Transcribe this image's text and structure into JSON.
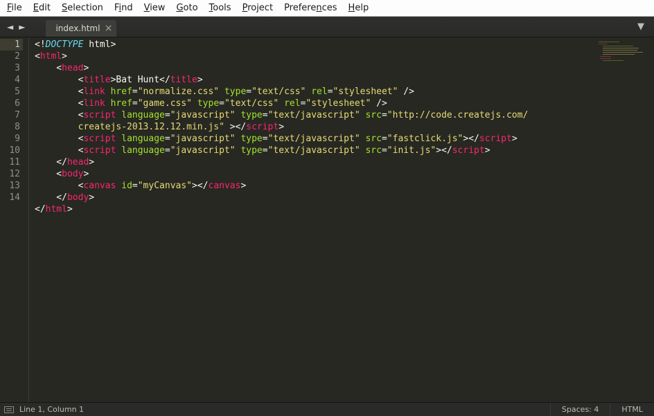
{
  "menubar": [
    {
      "label": "File",
      "ul": "F"
    },
    {
      "label": "Edit",
      "ul": "E"
    },
    {
      "label": "Selection",
      "ul": "S"
    },
    {
      "label": "Find",
      "ul": "i"
    },
    {
      "label": "View",
      "ul": "V"
    },
    {
      "label": "Goto",
      "ul": "G"
    },
    {
      "label": "Tools",
      "ul": "T"
    },
    {
      "label": "Project",
      "ul": "P"
    },
    {
      "label": "Preferences",
      "ul": "n"
    },
    {
      "label": "Help",
      "ul": "H"
    }
  ],
  "nav": {
    "back": "◄",
    "forward": "►",
    "panel_toggle": "▼"
  },
  "tab": {
    "title": "index.html",
    "close": "×"
  },
  "status": {
    "position": "Line 1, Column 1",
    "indent": "Spaces: 4",
    "syntax": "HTML"
  },
  "code": {
    "line_count": 14,
    "lines": [
      [
        [
          "p",
          "<!"
        ],
        [
          "d",
          "DOCTYPE"
        ],
        [
          "p",
          " html>"
        ]
      ],
      [
        [
          "p",
          "<"
        ],
        [
          "t",
          "html"
        ],
        [
          "p",
          ">"
        ]
      ],
      [
        [
          "p",
          "    <"
        ],
        [
          "t",
          "head"
        ],
        [
          "p",
          ">"
        ]
      ],
      [
        [
          "p",
          "        <"
        ],
        [
          "t",
          "title"
        ],
        [
          "p",
          ">Bat Hunt</"
        ],
        [
          "t",
          "title"
        ],
        [
          "p",
          ">"
        ]
      ],
      [
        [
          "p",
          "        <"
        ],
        [
          "t",
          "link"
        ],
        [
          "p",
          " "
        ],
        [
          "a",
          "href"
        ],
        [
          "p",
          "="
        ],
        [
          "s",
          "\"normalize.css\""
        ],
        [
          "p",
          " "
        ],
        [
          "a",
          "type"
        ],
        [
          "p",
          "="
        ],
        [
          "s",
          "\"text/css\""
        ],
        [
          "p",
          " "
        ],
        [
          "a",
          "rel"
        ],
        [
          "p",
          "="
        ],
        [
          "s",
          "\"stylesheet\""
        ],
        [
          "p",
          " />"
        ]
      ],
      [
        [
          "p",
          "        <"
        ],
        [
          "t",
          "link"
        ],
        [
          "p",
          " "
        ],
        [
          "a",
          "href"
        ],
        [
          "p",
          "="
        ],
        [
          "s",
          "\"game.css\""
        ],
        [
          "p",
          " "
        ],
        [
          "a",
          "type"
        ],
        [
          "p",
          "="
        ],
        [
          "s",
          "\"text/css\""
        ],
        [
          "p",
          " "
        ],
        [
          "a",
          "rel"
        ],
        [
          "p",
          "="
        ],
        [
          "s",
          "\"stylesheet\""
        ],
        [
          "p",
          " />"
        ]
      ],
      [
        [
          "p",
          "        <"
        ],
        [
          "t",
          "script"
        ],
        [
          "p",
          " "
        ],
        [
          "a",
          "language"
        ],
        [
          "p",
          "="
        ],
        [
          "s",
          "\"javascript\""
        ],
        [
          "p",
          " "
        ],
        [
          "a",
          "type"
        ],
        [
          "p",
          "="
        ],
        [
          "s",
          "\"text/javascript\""
        ],
        [
          "p",
          " "
        ],
        [
          "a",
          "src"
        ],
        [
          "p",
          "="
        ],
        [
          "s",
          "\"http://code.createjs.com/"
        ]
      ],
      [
        [
          "s",
          "        createjs-2013.12.12.min.js\""
        ],
        [
          "p",
          " ></"
        ],
        [
          "t",
          "script"
        ],
        [
          "p",
          ">"
        ]
      ],
      [
        [
          "p",
          "        <"
        ],
        [
          "t",
          "script"
        ],
        [
          "p",
          " "
        ],
        [
          "a",
          "language"
        ],
        [
          "p",
          "="
        ],
        [
          "s",
          "\"javascript\""
        ],
        [
          "p",
          " "
        ],
        [
          "a",
          "type"
        ],
        [
          "p",
          "="
        ],
        [
          "s",
          "\"text/javascript\""
        ],
        [
          "p",
          " "
        ],
        [
          "a",
          "src"
        ],
        [
          "p",
          "="
        ],
        [
          "s",
          "\"fastclick.js\""
        ],
        [
          "p",
          "></"
        ],
        [
          "t",
          "script"
        ],
        [
          "p",
          ">"
        ]
      ],
      [
        [
          "p",
          "        <"
        ],
        [
          "t",
          "script"
        ],
        [
          "p",
          " "
        ],
        [
          "a",
          "language"
        ],
        [
          "p",
          "="
        ],
        [
          "s",
          "\"javascript\""
        ],
        [
          "p",
          " "
        ],
        [
          "a",
          "type"
        ],
        [
          "p",
          "="
        ],
        [
          "s",
          "\"text/javascript\""
        ],
        [
          "p",
          " "
        ],
        [
          "a",
          "src"
        ],
        [
          "p",
          "="
        ],
        [
          "s",
          "\"init.js\""
        ],
        [
          "p",
          "></"
        ],
        [
          "t",
          "script"
        ],
        [
          "p",
          ">"
        ]
      ],
      [
        [
          "p",
          "    </"
        ],
        [
          "t",
          "head"
        ],
        [
          "p",
          ">"
        ]
      ],
      [
        [
          "p",
          "    <"
        ],
        [
          "t",
          "body"
        ],
        [
          "p",
          ">"
        ]
      ],
      [
        [
          "p",
          "        <"
        ],
        [
          "t",
          "canvas"
        ],
        [
          "p",
          " "
        ],
        [
          "a",
          "id"
        ],
        [
          "p",
          "="
        ],
        [
          "s",
          "\"myCanvas\""
        ],
        [
          "p",
          "></"
        ],
        [
          "t",
          "canvas"
        ],
        [
          "p",
          ">"
        ]
      ],
      [
        [
          "p",
          "    </"
        ],
        [
          "t",
          "body"
        ],
        [
          "p",
          ">"
        ]
      ],
      [
        [
          "p",
          "</"
        ],
        [
          "t",
          "html"
        ],
        [
          "p",
          ">"
        ]
      ]
    ]
  }
}
